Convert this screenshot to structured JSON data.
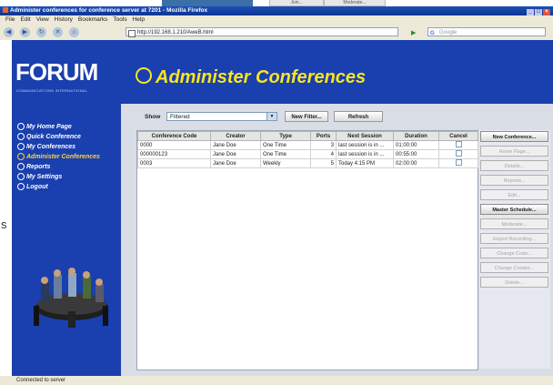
{
  "browser": {
    "window_title": "Administer conferences for conference server at 7201 - Mozilla Firefox",
    "menu": [
      "File",
      "Edit",
      "View",
      "History",
      "Bookmarks",
      "Tools",
      "Help"
    ],
    "url": "http://192.168.1.210/AweB.html",
    "search_placeholder": "Google",
    "status": "Connected to server",
    "thumb_tabs": [
      "Join...",
      "Moderate..."
    ]
  },
  "app": {
    "logo_text": "FORUM",
    "logo_subtitle": "COMMUNICATIONS INTERNATIONAL",
    "page_title": "Administer Conferences",
    "nav": [
      {
        "label": "My Home Page",
        "active": false
      },
      {
        "label": "Quick Conference",
        "active": false
      },
      {
        "label": "My Conferences",
        "active": false
      },
      {
        "label": "Administer Conferences",
        "active": true
      },
      {
        "label": "Reports",
        "active": false
      },
      {
        "label": "My Settings",
        "active": false
      },
      {
        "label": "Logout",
        "active": false
      }
    ]
  },
  "toolbar": {
    "show_label": "Show",
    "filter_value": "Filtered",
    "new_filter_label": "New Filter...",
    "refresh_label": "Refresh"
  },
  "table": {
    "columns": [
      "Conference Code",
      "Creator",
      "Type",
      "Ports",
      "Next Session",
      "Duration",
      "Cancel"
    ],
    "rows": [
      {
        "code": "0000",
        "creator": "Jane Doe",
        "type": "One Time",
        "ports": "3",
        "next": "last session is in ...",
        "duration": "01:00:00"
      },
      {
        "code": "000000123",
        "creator": "Jane Doe",
        "type": "One Time",
        "ports": "4",
        "next": "last session is in ...",
        "duration": "00:55:00"
      },
      {
        "code": "0003",
        "creator": "Jane Doe",
        "type": "Weekly",
        "ports": "5",
        "next": "Today 4:15 PM",
        "duration": "02:00:00"
      }
    ]
  },
  "actions": [
    {
      "label": "New Conference...",
      "enabled": true
    },
    {
      "label": "Home Page...",
      "enabled": false
    },
    {
      "label": "Details...",
      "enabled": false
    },
    {
      "label": "Reports...",
      "enabled": false
    },
    {
      "label": "Edit...",
      "enabled": false
    },
    {
      "label": "Master Schedule...",
      "enabled": true
    },
    {
      "label": "Moderate...",
      "enabled": false
    },
    {
      "label": "Export Recording...",
      "enabled": false
    },
    {
      "label": "Change Code...",
      "enabled": false
    },
    {
      "label": "Change Creator...",
      "enabled": false
    },
    {
      "label": "Delete...",
      "enabled": false
    }
  ],
  "colors": {
    "brand_blue": "#1a3fae",
    "title_yellow": "#f8e51f",
    "active_nav": "#ffd23a",
    "panel_bg": "#d9dee6"
  },
  "side_fragment": "s"
}
